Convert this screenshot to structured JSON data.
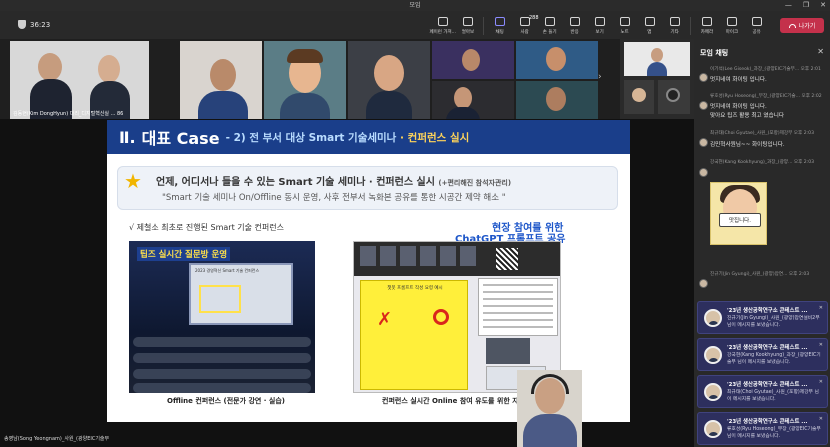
{
  "window": {
    "title": "모임",
    "controls": [
      "—",
      "❐",
      "✕"
    ]
  },
  "toolbar": {
    "timer": "36:23",
    "items": [
      {
        "label": "페이런 가져...",
        "icon": "window-icon"
      },
      {
        "label": "얼아보",
        "icon": "hand-icon"
      },
      {
        "label": "채팅",
        "icon": "chat-icon",
        "active": true
      },
      {
        "label": "사람",
        "icon": "people-icon",
        "badge": "288"
      },
      {
        "label": "손 들기",
        "icon": "raise-hand-icon"
      },
      {
        "label": "반응",
        "icon": "react-icon"
      },
      {
        "label": "보기",
        "icon": "view-icon"
      },
      {
        "label": "노트",
        "icon": "notes-icon"
      },
      {
        "label": "앱",
        "icon": "apps-icon"
      },
      {
        "label": "기타",
        "icon": "more-icon"
      },
      {
        "label": "카메라",
        "icon": "camera-icon"
      },
      {
        "label": "마이크",
        "icon": "mic-icon"
      },
      {
        "label": "공유",
        "icon": "share-icon"
      }
    ],
    "leave": "나가기"
  },
  "tiles": {
    "first_name": "김동현(Kim DongHyun) 대리_디지털혁신실 ...",
    "first_extra": "86"
  },
  "slide": {
    "num": "Ⅱ.",
    "case": "대표 Case",
    "subtitle_a": "- 2) 전 부서 대상 Smart 기술세미나",
    "subtitle_b": " · 컨퍼런스 실시",
    "banner_line1": "언제, 어디서나 들을 수 있는 Smart 기술 세미나 · 컨퍼런스 실시",
    "banner_line1_small": "(+편리해진 참석자관리)",
    "banner_line2": "\"Smart 기술 세미나 On/Offline 동시 운영, 사후 전부서 녹화본 공유를 통한 시공간 제약 해소 \"",
    "check": "√  제철소 최초로 진행된 Smart 기술 컨퍼런스",
    "tips_label": "팁즈 실시간 질문방 운영",
    "blue1": "현장 참여를 위한",
    "blue2": "ChatGPT 프롬프트 공유",
    "cap_left": "Offline 컨퍼런스 (전문가 강연 · 실습)",
    "cap_right": "컨퍼런스 실시간 Online 참여 유도를 위한 자료 공유"
  },
  "stage_name": "송영남(Song Yeongnam)_사원_(광양EIC기술부",
  "chat": {
    "title": "모임 채팅",
    "messages": [
      {
        "meta": "이기석(Lee Giseok)_과장_(광양EIC기술부...  오후 2:01",
        "text": "멋지네여 화이팅 입니다."
      },
      {
        "meta": "류호성(Ryu Hoseong)_부장_(광양EIC기술...  오후 2:02",
        "text": "멋지네여 화이팅 입니다."
      },
      {
        "meta": "",
        "text": "맞아요 팁즈 활용 최고 였습니다"
      },
      {
        "meta": "최규태(Choi Gyutae)_사원_(포항)제강부   오후 2:03",
        "text": "김민혁사원님~~ 화이팅입니다."
      },
      {
        "meta": "강국현(Kang Kookhyung)_과장_(광양...  오후 2:03",
        "text": ""
      },
      {
        "meta": "진규기(Jin Gyungi)_사원_(광양)압연...  오후 2:03",
        "text": ""
      }
    ],
    "sticker_text": "맛집니다."
  },
  "notifications": [
    {
      "title": "'23년 생산공학연구소 콘테스트 ...",
      "body": "진규기(Jin Gyungi)_사원_(광양)압연설비2부 님이 메시지를 보냈습니다."
    },
    {
      "title": "'23년 생산공학연구소 콘테스트 ...",
      "body": "강국현(Kang Kookhyung)_과장_(광양EIC기술부 님이 메시지를 보냈습니다."
    },
    {
      "title": "'23년 생산공학연구소 콘테스트 ...",
      "body": "최규태(Choi Gyutae)_사원_(포항)제강부 님이 메시지를 보냈습니다."
    },
    {
      "title": "'23년 생산공학연구소 콘테스트 ...",
      "body": "류호성(Ryu Hoseong)_부장_(광양EIC기술부 님이 메시지를 보냈습니다."
    }
  ]
}
